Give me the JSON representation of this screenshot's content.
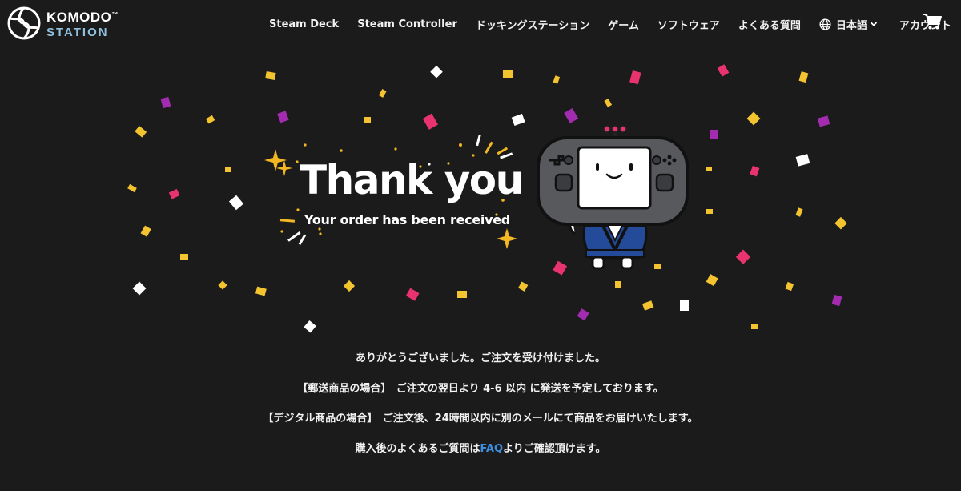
{
  "brand": {
    "name_line1": "KOMODO",
    "trademark": "™",
    "name_line2": "STATION",
    "accent_color": "#8fc0de"
  },
  "nav": {
    "items": [
      {
        "label": "Steam Deck"
      },
      {
        "label": "Steam Controller"
      },
      {
        "label": "ドッキングステーション"
      },
      {
        "label": "ゲーム"
      },
      {
        "label": "ソフトウェア"
      },
      {
        "label": "よくある質問"
      }
    ],
    "language": {
      "label": "日本語",
      "icon": "globe-icon",
      "chevron": "chevron-down-icon"
    },
    "account": "アカウント",
    "cart_icon": "cart-icon"
  },
  "hero": {
    "title": "Thank you",
    "subtitle": "Your order has been received",
    "mascot": "komodo-mascot-illustration"
  },
  "messages": {
    "line1": "ありがとうございました。ご注文を受け付けました。",
    "line2": "【郵送商品の場合】　ご注文の翌日より 4-6 以内 に発送を予定しております。",
    "line3": "【デジタル商品の場合】　ご注文後、24時間以内に別のメールにて商品をお届けいたします。",
    "line4_before": "購入後のよくあるご質問は",
    "line4_link": "FAQ",
    "line4_after": "よりご確認頂けます。"
  },
  "colors": {
    "background": "#1b1b1c",
    "link": "#3d8fe0",
    "confetti": [
      "#f4c430",
      "#e8336e",
      "#a22bb0",
      "#ffffff"
    ]
  }
}
